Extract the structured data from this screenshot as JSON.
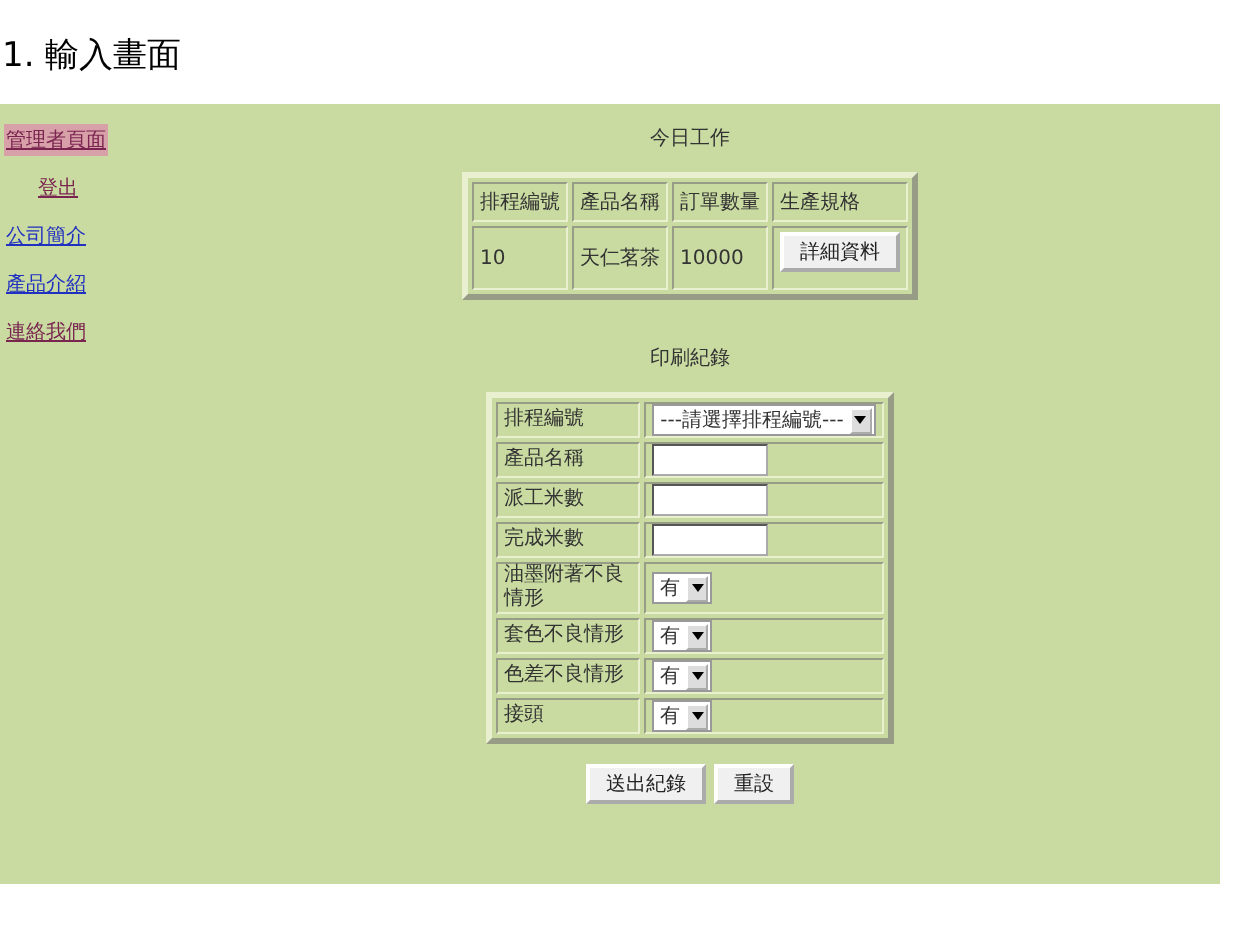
{
  "heading": "1. 輸入畫面",
  "sidebar": {
    "items": [
      {
        "label": "管理者頁面",
        "visited": true,
        "selected": true
      },
      {
        "label": "登出",
        "visited": true,
        "selected": false
      },
      {
        "label": "公司簡介",
        "visited": false,
        "selected": false
      },
      {
        "label": "產品介紹",
        "visited": false,
        "selected": false
      },
      {
        "label": "連絡我們",
        "visited": true,
        "selected": false
      }
    ]
  },
  "today": {
    "title": "今日工作",
    "columns": [
      "排程編號",
      "產品名稱",
      "訂單數量",
      "生產規格"
    ],
    "rows": [
      {
        "cells": [
          "10",
          "天仁茗茶",
          "10000"
        ],
        "button": "詳細資料"
      }
    ]
  },
  "record": {
    "title": "印刷紀錄",
    "fields": [
      {
        "label": "排程編號",
        "kind": "select",
        "value": "---請選擇排程編號---"
      },
      {
        "label": "產品名稱",
        "kind": "text"
      },
      {
        "label": "派工米數",
        "kind": "text"
      },
      {
        "label": "完成米數",
        "kind": "text"
      },
      {
        "label": "油墨附著不良情形",
        "kind": "select",
        "value": "有"
      },
      {
        "label": "套色不良情形",
        "kind": "select",
        "value": "有"
      },
      {
        "label": "色差不良情形",
        "kind": "select",
        "value": "有"
      },
      {
        "label": "接頭",
        "kind": "select",
        "value": "有"
      }
    ],
    "buttons": [
      "送出紀錄",
      "重設"
    ]
  }
}
